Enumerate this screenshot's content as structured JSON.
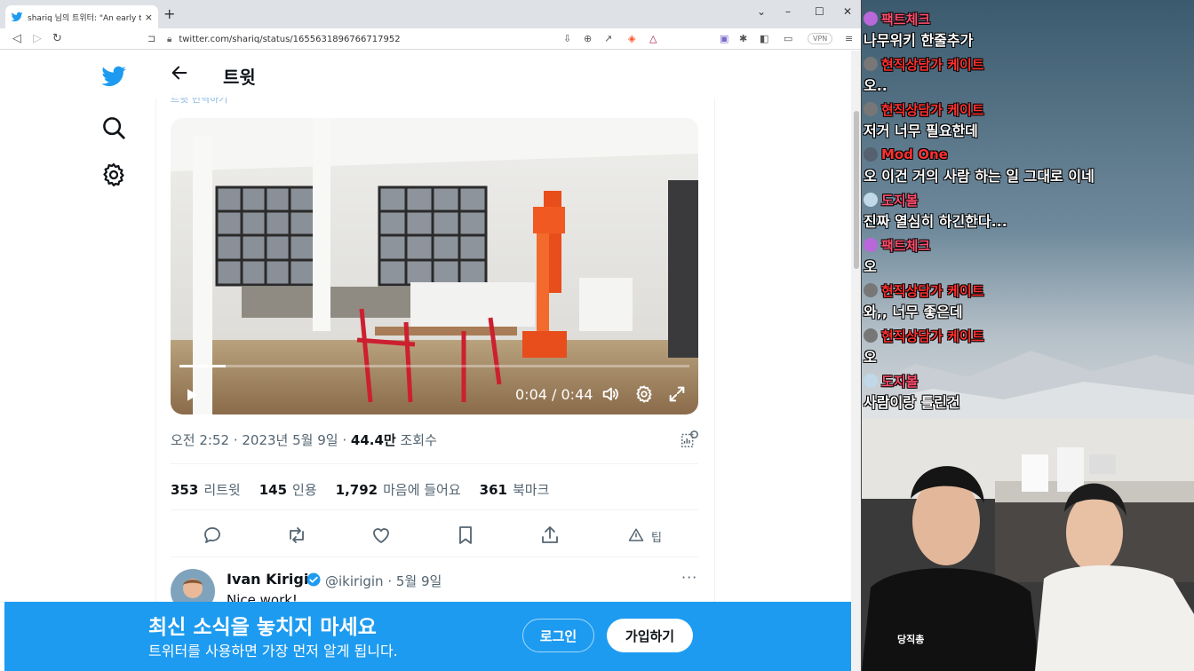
{
  "browser": {
    "tab_title": "shariq 님의 트위터: \"An early tim",
    "tab_close": "×",
    "new_tab": "+",
    "url": "twitter.com/shariq/status/1655631896766717952",
    "vpn_label": "VPN",
    "controls": {
      "minimize": "–",
      "maximize": "☐",
      "close": "✕",
      "dropdown": "⌄"
    }
  },
  "twitter": {
    "header_title": "트윗",
    "faded_text": "트윗 번역하기",
    "video": {
      "time": "0:04 / 0:44",
      "progress": 0.09
    },
    "meta": {
      "time": "오전 2:52",
      "date": "2023년 5월 9일",
      "views": "44.4만",
      "views_label": "조회수",
      "sep": " · "
    },
    "stats": [
      {
        "count": "353",
        "label": "리트윗"
      },
      {
        "count": "145",
        "label": "인용"
      },
      {
        "count": "1,792",
        "label": "마음에 들어요"
      },
      {
        "count": "361",
        "label": "북마크"
      }
    ],
    "tip_label": "팁",
    "reply": {
      "name": "Ivan Kirigin",
      "handle": "@ikirigin · 5월 9일",
      "text": "Nice work!",
      "more": "···"
    },
    "banner": {
      "title": "최신 소식을 놓치지 마세요",
      "subtitle": "트위터를 사용하면 가장 먼저 알게 됩니다.",
      "login": "로그인",
      "signup": "가입하기"
    }
  },
  "chat": [
    {
      "name": "팩트체크",
      "name_color": "#ff4d6d",
      "avatar_color": "#b868d8",
      "text": "나무위키 한줄추가"
    },
    {
      "name": "현직상담가 케이트",
      "name_color": "#ff3030",
      "avatar_color": "#777777",
      "text": "오.."
    },
    {
      "name": "현직상담가 케이트",
      "name_color": "#ff3030",
      "avatar_color": "#777777",
      "text": "저거 너무 필요한데"
    },
    {
      "name": "Mod One",
      "name_color": "#ff3030",
      "avatar_color": "#556070",
      "text": "오 이건 거의 사람 하는 일 그대로 이네"
    },
    {
      "name": "도지볼",
      "name_color": "#ff4d6d",
      "avatar_color": "#c0d8e8",
      "text": "진짜 열심히 하긴한다..."
    },
    {
      "name": "팩트체크",
      "name_color": "#ff4d6d",
      "avatar_color": "#b868d8",
      "text": "오"
    },
    {
      "name": "현직상담가 케이트",
      "name_color": "#ff3030",
      "avatar_color": "#777777",
      "text": "와,, 너무 좋은데"
    },
    {
      "name": "현직상담가 케이트",
      "name_color": "#ff3030",
      "avatar_color": "#777777",
      "text": "오"
    },
    {
      "name": "도지볼",
      "name_color": "#ff4d6d",
      "avatar_color": "#c0d8e8",
      "text": "사람이랑 틀린건"
    }
  ],
  "webcam": {
    "shirt_text": "당직총"
  },
  "colors": {
    "twitter_blue": "#1d9bf0",
    "text_primary": "#0f1419",
    "text_secondary": "#536471"
  }
}
